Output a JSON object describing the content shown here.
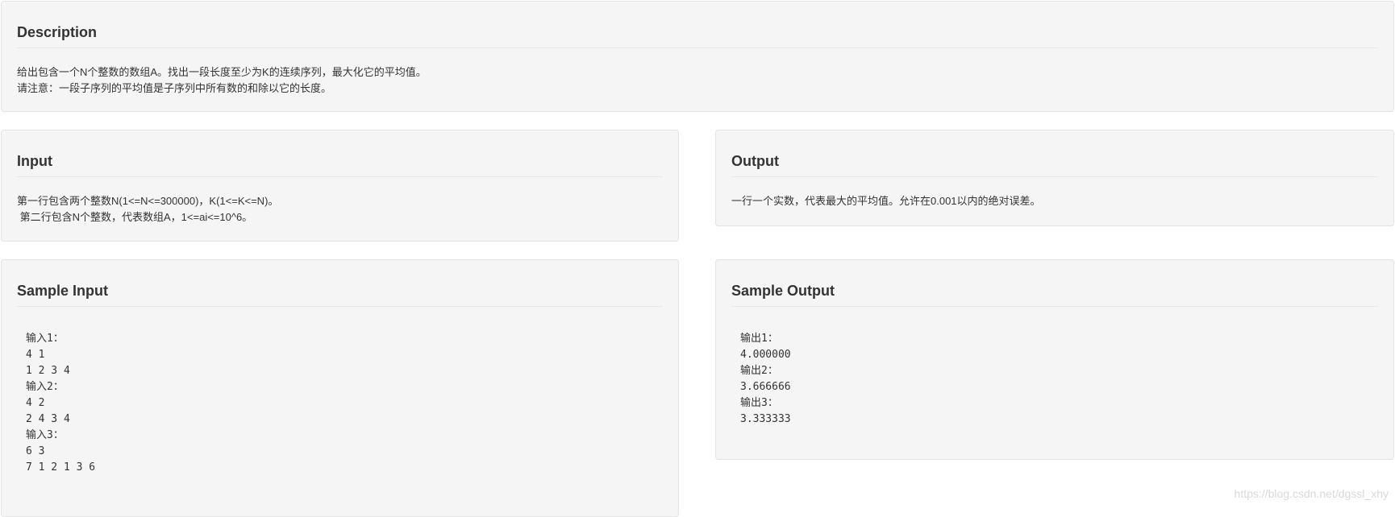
{
  "description": {
    "title": "Description",
    "lines": [
      "给出包含一个N个整数的数组A。找出一段长度至少为K的连续序列，最大化它的平均值。",
      "请注意：一段子序列的平均值是子序列中所有数的和除以它的长度。"
    ]
  },
  "input": {
    "title": "Input",
    "lines": [
      "第一行包含两个整数N(1<=N<=300000)，K(1<=K<=N)。",
      " 第二行包含N个整数，代表数组A，1<=ai<=10^6。"
    ]
  },
  "output": {
    "title": "Output",
    "lines": [
      "一行一个实数，代表最大的平均值。允许在0.001以内的绝对误差。"
    ]
  },
  "sample_input": {
    "title": "Sample Input",
    "lines": [
      "输入1：",
      "4 1",
      "1 2 3 4",
      "输入2：",
      "4 2",
      "2 4 3 4",
      "输入3：",
      "6 3",
      "7 1 2 1 3 6"
    ]
  },
  "sample_output": {
    "title": "Sample Output",
    "lines": [
      "输出1：",
      "4.000000",
      "输出2：",
      "3.666666",
      "输出3：",
      "3.333333"
    ]
  },
  "watermark": "https://blog.csdn.net/dgssl_xhy"
}
